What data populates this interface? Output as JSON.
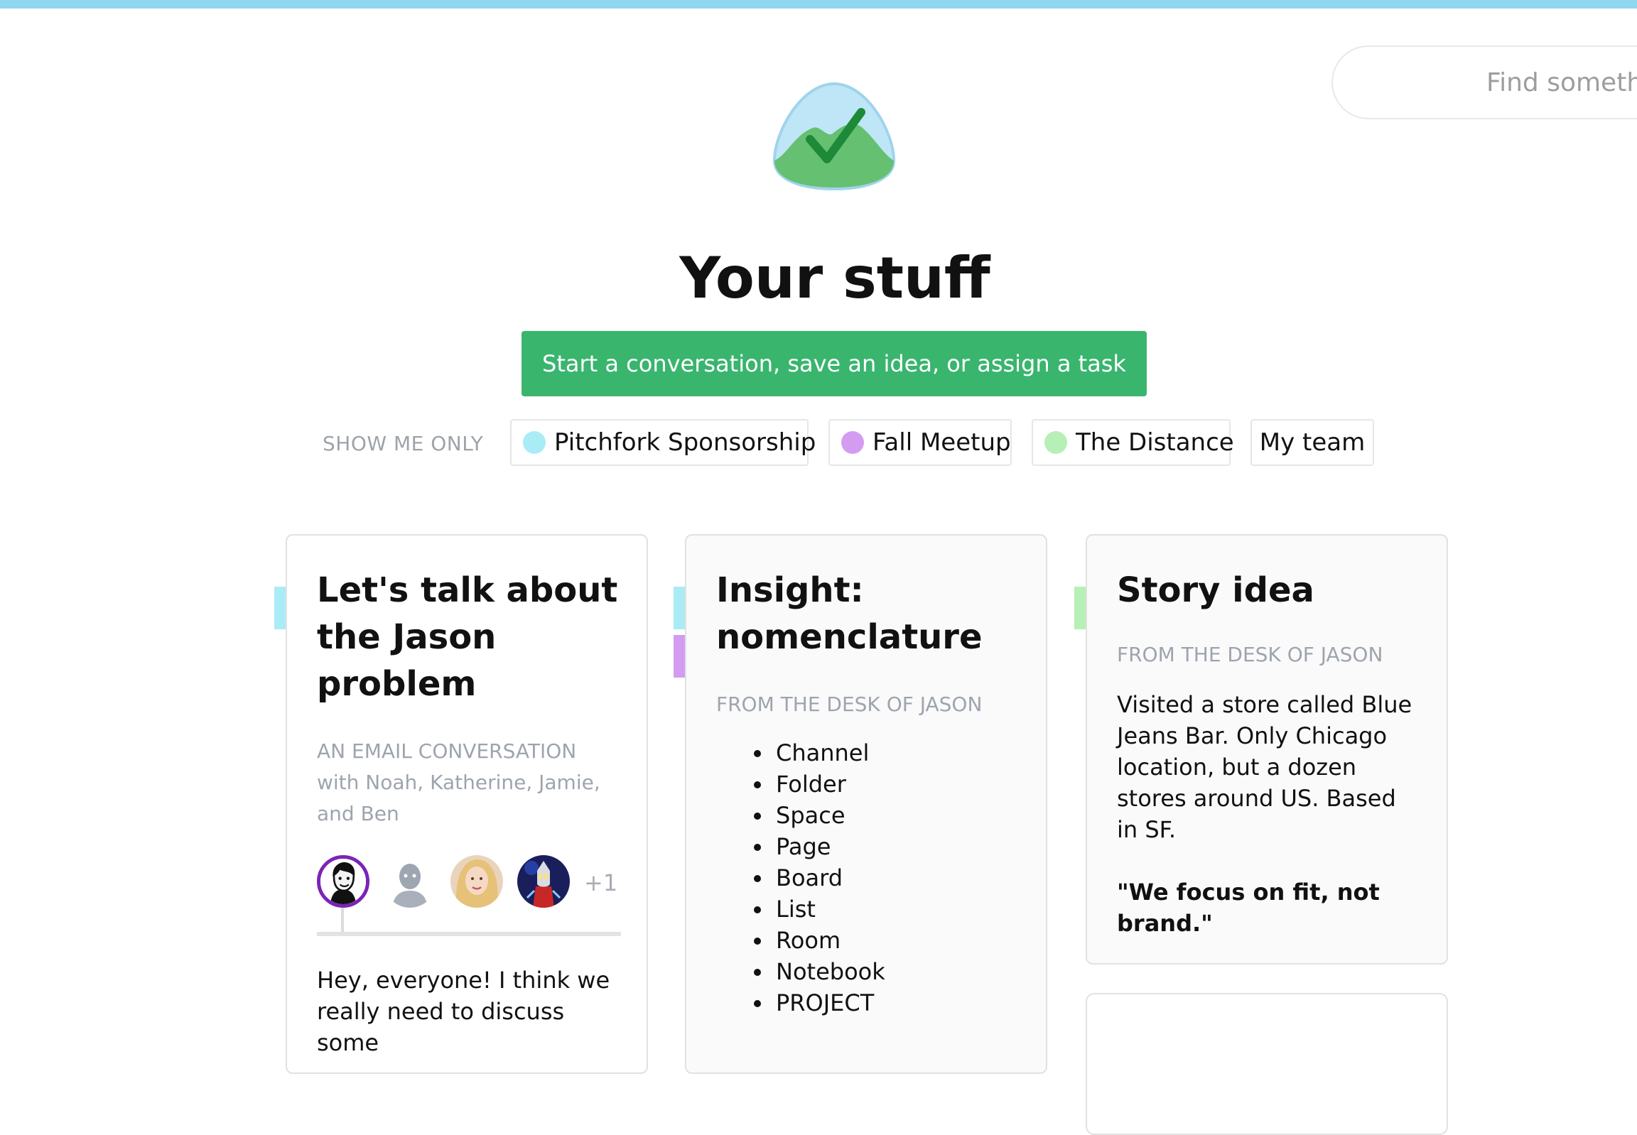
{
  "search": {
    "placeholder": "Find something…"
  },
  "page": {
    "title": "Your stuff"
  },
  "cta": {
    "label": "Start a conversation, save an idea, or assign a task"
  },
  "filters": {
    "label": "SHOW ME ONLY",
    "chips": [
      {
        "label": "Pitchfork Sponsorship",
        "color": "#a9ecf6"
      },
      {
        "label": "Fall Meetup",
        "color": "#d39cf1"
      },
      {
        "label": "The Distance",
        "color": "#b6f0b6"
      },
      {
        "label": "My team"
      }
    ]
  },
  "cards": [
    {
      "title": "Let's talk about the Jason problem",
      "meta_upper": "AN EMAIL CONVERSATION",
      "meta_with": " with Noah, Katherine, Jamie, and Ben",
      "avatar_extra": "+1",
      "body": "Hey, everyone! I think we really need to discuss some",
      "flags": [
        "#a9ecf6"
      ]
    },
    {
      "title": "Insight: nomenclature",
      "meta": "FROM THE DESK OF JASON",
      "items": [
        "Channel",
        "Folder",
        "Space",
        "Page",
        "Board",
        "List",
        "Room",
        "Notebook",
        "PROJECT"
      ],
      "flags": [
        "#a9ecf6",
        "#d39cf1"
      ]
    },
    {
      "title": "Story idea",
      "meta": "FROM THE DESK OF JASON",
      "body": "Visited a store called Blue Jeans Bar. Only Chicago location, but a dozen stores around US. Based in SF.",
      "quote": "\"We focus on fit, not brand.\"",
      "flags": [
        "#b6f0b6"
      ]
    }
  ],
  "colors": {
    "top_bar": "#8fd6ee",
    "accent_green": "#39b56e",
    "meta_gray": "#9ea4ae"
  },
  "icons": {
    "logo": "basecamp-mountain-check-logo"
  }
}
